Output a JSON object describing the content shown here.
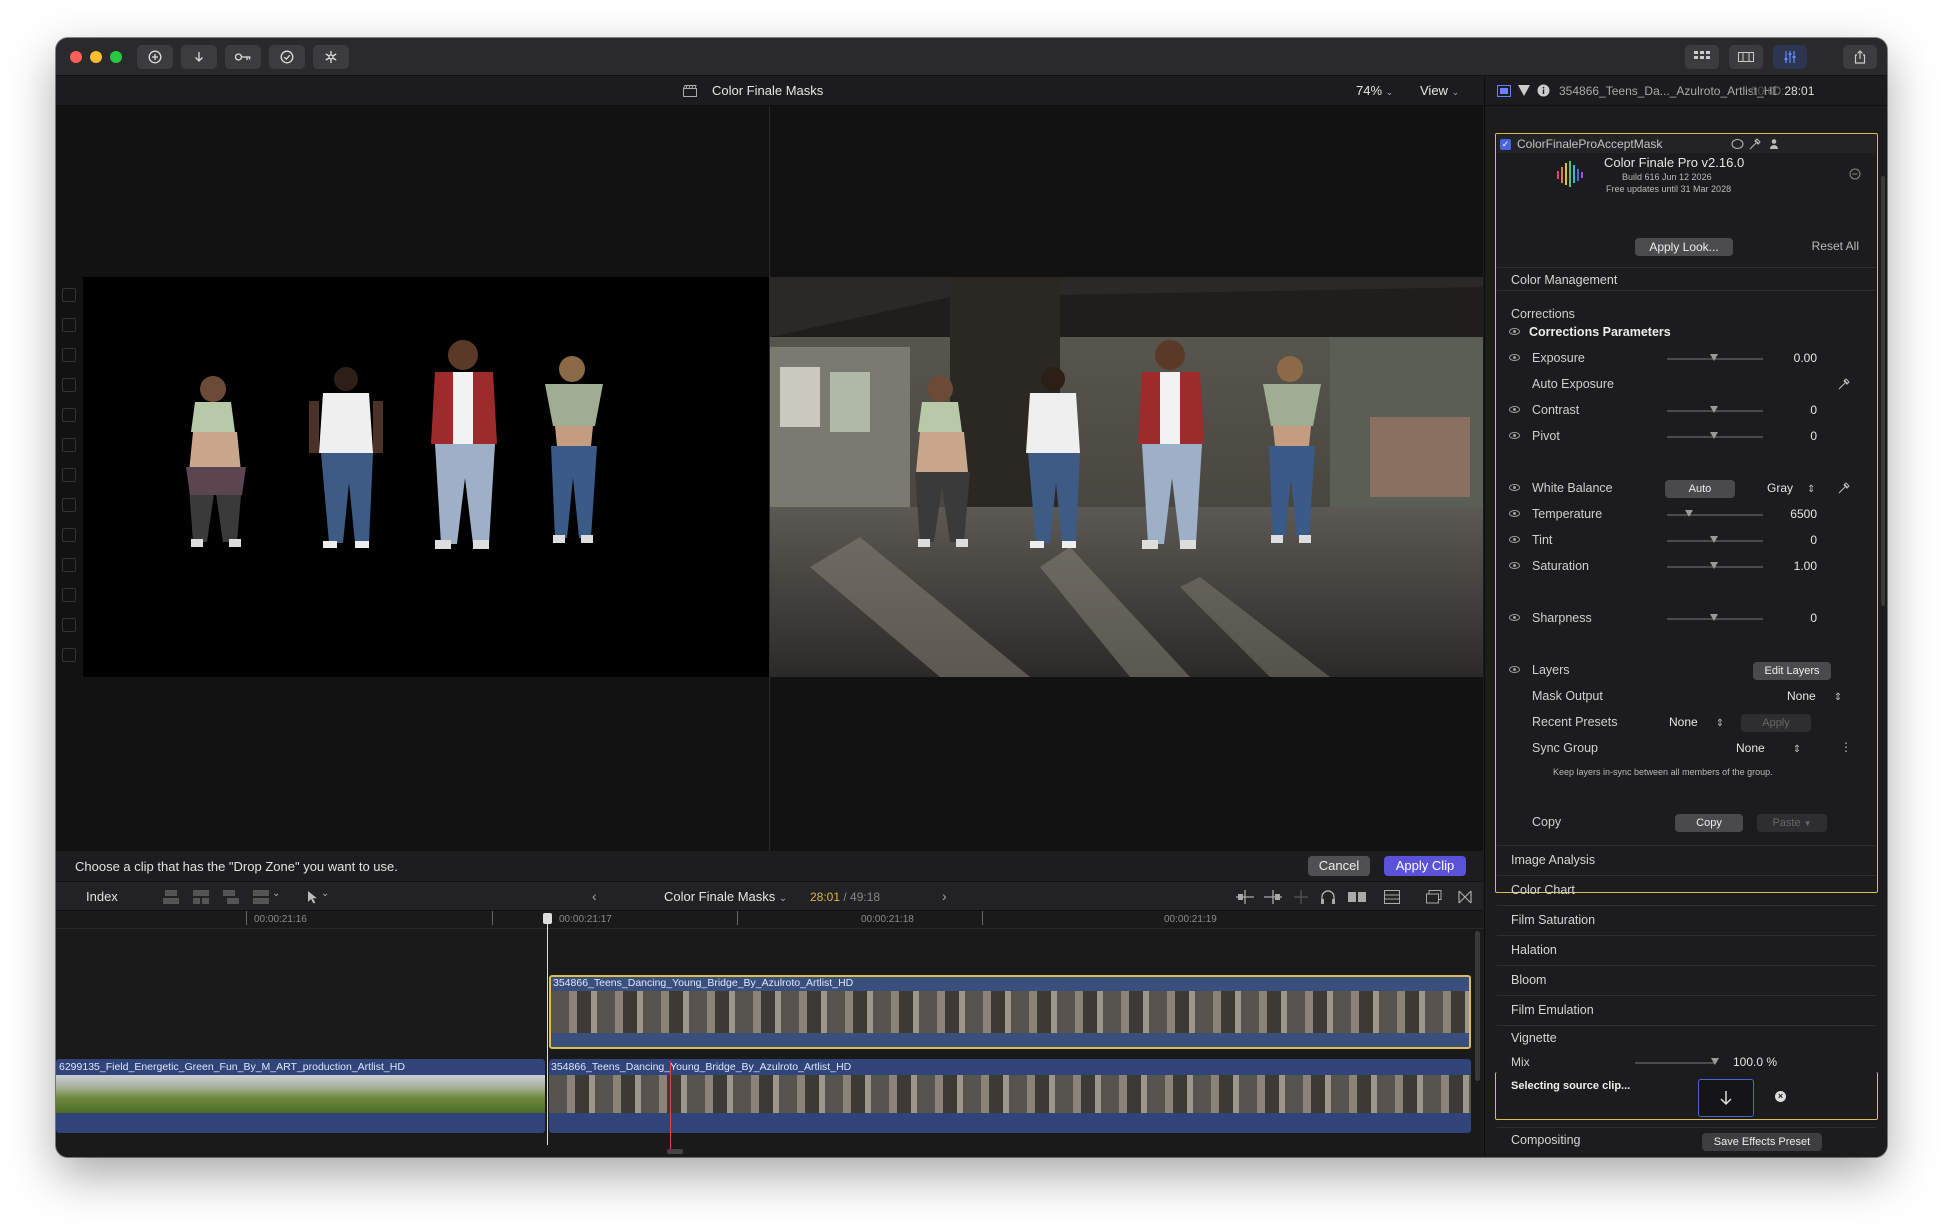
{
  "window": {
    "project_title": "Color Finale Masks",
    "zoom": "74%",
    "view_label": "View"
  },
  "titlebar": {
    "icons": [
      "plus-circle-icon",
      "download-icon",
      "key-icon",
      "checkmark-icon",
      "snowflake-icon"
    ],
    "right_icons": [
      "grid-icon",
      "filmstrip-icon",
      "sliders-icon",
      "share-icon"
    ]
  },
  "prompt": {
    "text": "Choose a clip that has the \"Drop Zone\" you want to use.",
    "cancel": "Cancel",
    "apply": "Apply Clip"
  },
  "timeline_bar": {
    "index": "Index",
    "project": "Color Finale Masks",
    "timecode": "28:01",
    "duration": "49:18",
    "sep": " / "
  },
  "ruler": [
    "00:00:21:16",
    "00:00:21:17",
    "00:00:21:18",
    "00:00:21:19"
  ],
  "clips": {
    "top": "354866_Teens_Dancing_Young_Bridge_By_Azulroto_Artlist_HD",
    "bottom_left": "6299135_Field_Energetic_Green_Fun_By_M_ART_production_Artlist_HD",
    "bottom_right": "354866_Teens_Dancing_Young_Bridge_By_Azulroto_Artlist_HD"
  },
  "inspector": {
    "clip_name": "354866_Teens_Da..._Azulroto_Artlist_HD",
    "clip_time_faded": "00:00:",
    "clip_time": "28:01",
    "effect_name": "ColorFinaleProAcceptMask",
    "plugin": {
      "name": "Color Finale Pro v2.16.0",
      "build": "Build 616 Jun 12 2026",
      "updates": "Free updates until 31 Mar 2028"
    },
    "apply_look": "Apply Look...",
    "reset_all": "Reset All",
    "color_management": "Color Management",
    "corrections": "Corrections",
    "corrections_params": "Corrections Parameters",
    "params": [
      {
        "label": "Exposure",
        "value": "0.00",
        "pos": 0.5
      },
      {
        "label": "Contrast",
        "value": "0",
        "pos": 0.5
      },
      {
        "label": "Pivot",
        "value": "0",
        "pos": 0.5
      },
      {
        "label": "Temperature",
        "value": "6500",
        "pos": 0.24
      },
      {
        "label": "Tint",
        "value": "0",
        "pos": 0.5
      },
      {
        "label": "Saturation",
        "value": "1.00",
        "pos": 0.5
      },
      {
        "label": "Sharpness",
        "value": "0",
        "pos": 0.5
      }
    ],
    "auto_exposure": "Auto Exposure",
    "white_balance": {
      "label": "White Balance",
      "auto": "Auto",
      "mode": "Gray"
    },
    "layers": {
      "label": "Layers",
      "edit": "Edit Layers"
    },
    "mask_output": {
      "label": "Mask Output",
      "value": "None"
    },
    "recent_presets": {
      "label": "Recent Presets",
      "value": "None",
      "apply": "Apply"
    },
    "sync_group": {
      "label": "Sync Group",
      "value": "None",
      "note": "Keep layers in-sync between all members of the group."
    },
    "copy": {
      "label": "Copy",
      "copy_btn": "Copy",
      "paste_btn": "Paste"
    },
    "sections": [
      "Image Analysis",
      "Color Chart",
      "Film Saturation",
      "Halation",
      "Bloom",
      "Film Emulation"
    ],
    "vignette": {
      "label": "Vignette",
      "mix_label": "Mix",
      "mix_value": "100.0",
      "mix_unit": "%",
      "mix_pos": 0.98
    },
    "selecting": "Selecting source clip...",
    "compositing": "Compositing",
    "save_preset": "Save Effects Preset"
  }
}
